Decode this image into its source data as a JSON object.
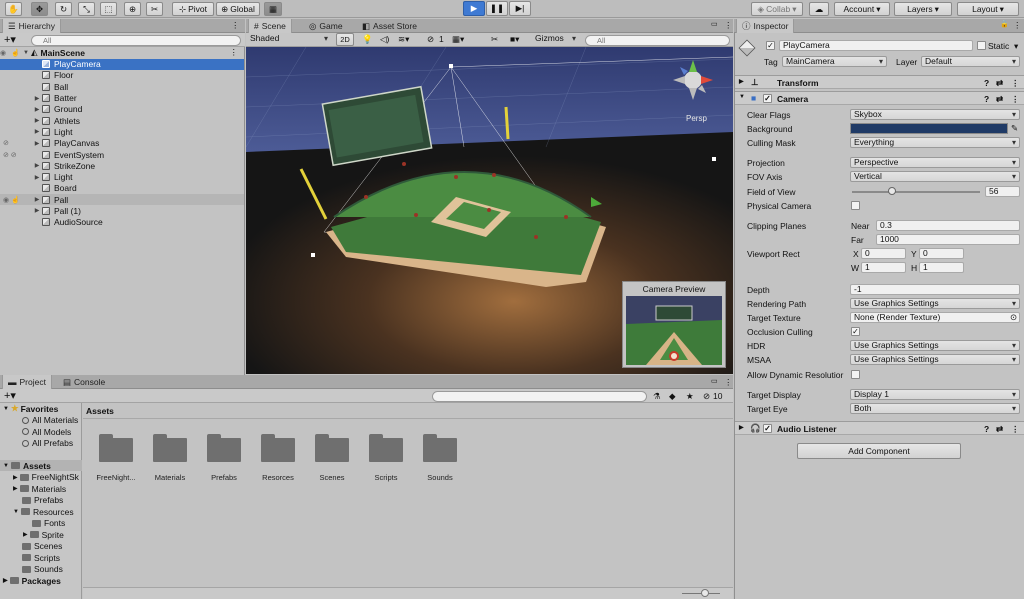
{
  "toolbar": {
    "pivot_label": "Pivot",
    "global_label": "Global",
    "collab_label": "Collab",
    "account_label": "Account",
    "layers_label": "Layers",
    "layout_label": "Layout"
  },
  "hierarchy": {
    "tab_label": "Hierarchy",
    "search_placeholder": "All",
    "scene_name": "MainScene",
    "items": [
      {
        "label": "PlayCamera"
      },
      {
        "label": "Floor"
      },
      {
        "label": "Ball"
      },
      {
        "label": "Batter"
      },
      {
        "label": "Ground"
      },
      {
        "label": "Athlets"
      },
      {
        "label": "Light"
      },
      {
        "label": "PlayCanvas"
      },
      {
        "label": "EventSystem"
      },
      {
        "label": "StrikeZone"
      },
      {
        "label": "Light"
      },
      {
        "label": "Board"
      },
      {
        "label": "Pall"
      },
      {
        "label": "Pall (1)"
      },
      {
        "label": "AudioSource"
      }
    ]
  },
  "scene": {
    "tabs": [
      "Scene",
      "Game",
      "Asset Store"
    ],
    "shading_mode": "Shaded",
    "mode_2d": "2D",
    "gizmos_label": "Gizmos",
    "search_placeholder": "All",
    "hidden_count": "1",
    "persp_label": "Persp",
    "camera_preview_title": "Camera Preview"
  },
  "project": {
    "tabs": [
      "Project",
      "Console"
    ],
    "favorites_label": "Favorites",
    "favorites": [
      "All Materials",
      "All Models",
      "All Prefabs"
    ],
    "assets_label": "Assets",
    "asset_tree": [
      "FreeNightSk",
      "Materials",
      "Prefabs",
      "Resources",
      "Fonts",
      "Sprite",
      "Scenes",
      "Scripts",
      "Sounds"
    ],
    "packages_label": "Packages",
    "breadcrumb": "Assets",
    "folders": [
      "FreeNight...",
      "Materials",
      "Prefabs",
      "Resorces",
      "Scenes",
      "Scripts",
      "Sounds"
    ],
    "hidden_count": "10"
  },
  "inspector": {
    "tab_label": "Inspector",
    "object_name": "PlayCamera",
    "static_label": "Static",
    "tag_label": "Tag",
    "tag_value": "MainCamera",
    "layer_label": "Layer",
    "layer_value": "Default",
    "transform_label": "Transform",
    "camera_label": "Camera",
    "camera_props": {
      "clear_flags_label": "Clear Flags",
      "clear_flags_value": "Skybox",
      "background_label": "Background",
      "culling_mask_label": "Culling Mask",
      "culling_mask_value": "Everything",
      "projection_label": "Projection",
      "projection_value": "Perspective",
      "fov_axis_label": "FOV Axis",
      "fov_axis_value": "Vertical",
      "fov_label": "Field of View",
      "fov_value": "56",
      "physical_camera_label": "Physical Camera",
      "clipping_planes_label": "Clipping Planes",
      "near_label": "Near",
      "near_value": "0.3",
      "far_label": "Far",
      "far_value": "1000",
      "viewport_rect_label": "Viewport Rect",
      "vx_label": "X",
      "vx_value": "0",
      "vy_label": "Y",
      "vy_value": "0",
      "vw_label": "W",
      "vw_value": "1",
      "vh_label": "H",
      "vh_value": "1",
      "depth_label": "Depth",
      "depth_value": "-1",
      "rendering_path_label": "Rendering Path",
      "rendering_path_value": "Use Graphics Settings",
      "target_texture_label": "Target Texture",
      "target_texture_value": "None (Render Texture)",
      "occlusion_culling_label": "Occlusion Culling",
      "hdr_label": "HDR",
      "hdr_value": "Use Graphics Settings",
      "msaa_label": "MSAA",
      "msaa_value": "Use Graphics Settings",
      "allow_dynamic_label": "Allow Dynamic Resolutior",
      "target_display_label": "Target Display",
      "target_display_value": "Display 1",
      "target_eye_label": "Target Eye",
      "target_eye_value": "Both"
    },
    "audio_listener_label": "Audio Listener",
    "add_component_label": "Add Component",
    "background_color": "#1f3a66"
  }
}
